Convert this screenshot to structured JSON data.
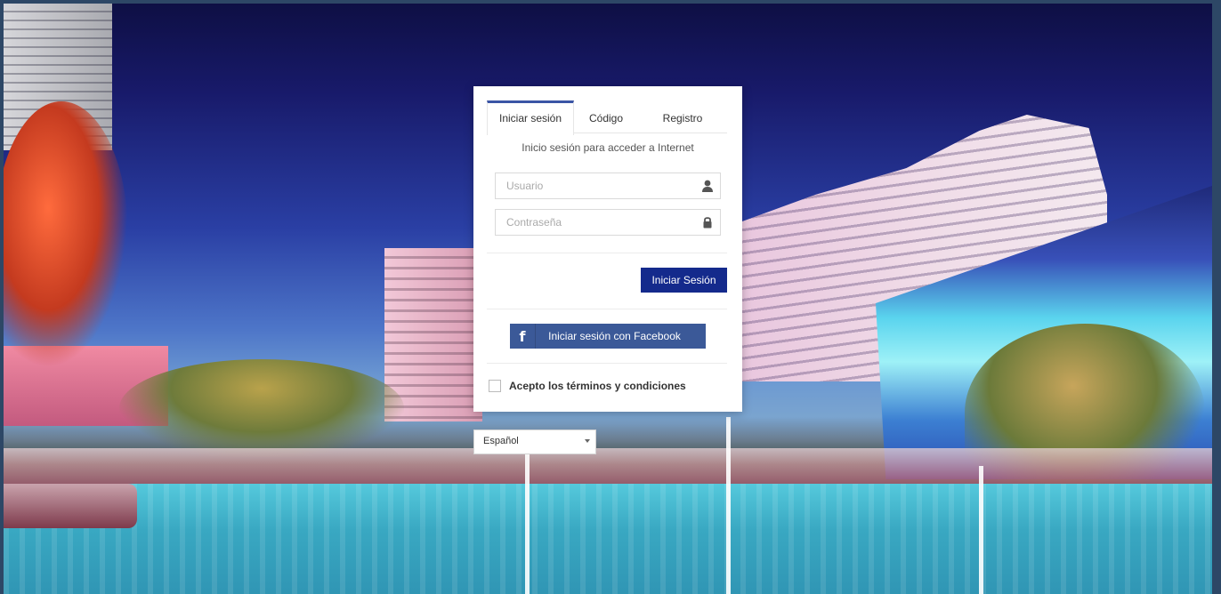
{
  "tabs": [
    {
      "label": "Iniciar sesión",
      "active": true
    },
    {
      "label": "Código",
      "active": false
    },
    {
      "label": "Registro",
      "active": false
    }
  ],
  "login": {
    "subtitle": "Inicio sesión para acceder a Internet",
    "username": {
      "placeholder": "Usuario",
      "value": "",
      "icon": "user-icon"
    },
    "password": {
      "placeholder": "Contraseña",
      "value": "",
      "icon": "lock-icon"
    },
    "submit_label": "Iniciar Sesión",
    "facebook_label": "Iniciar sesión con Facebook",
    "facebook_icon": "facebook-icon",
    "terms_label": "Acepto los términos y condiciones",
    "terms_checked": false
  },
  "language": {
    "selected": "Español",
    "icon": "chevron-down-icon"
  },
  "colors": {
    "primary_button": "#142a8c",
    "facebook": "#3b5998",
    "tab_accent": "#3b55a5"
  }
}
